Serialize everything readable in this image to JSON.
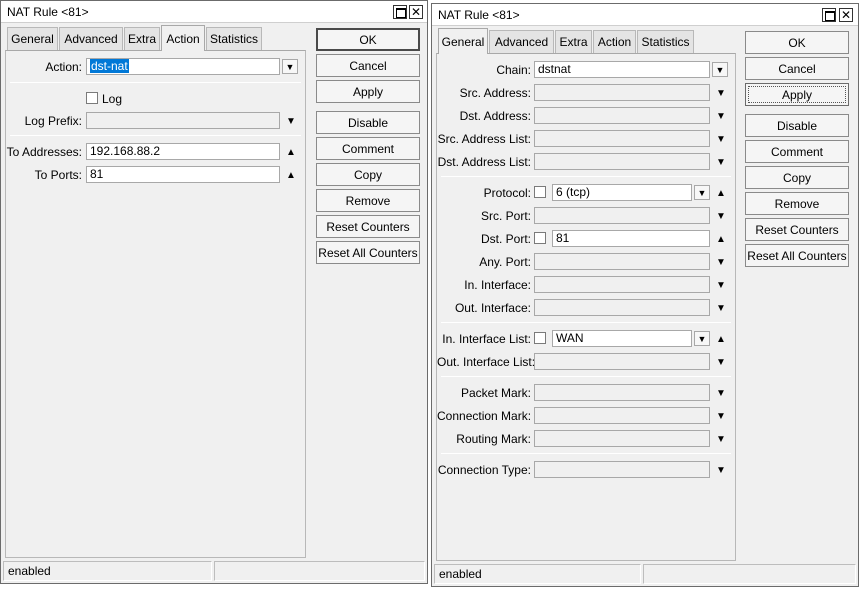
{
  "window1": {
    "title": "NAT Rule <81>",
    "tabs": [
      "General",
      "Advanced",
      "Extra",
      "Action",
      "Statistics"
    ],
    "active_tab": "Action",
    "fields": {
      "action_label": "Action:",
      "action_value": "dst-nat",
      "log_label": "Log",
      "log_prefix_label": "Log Prefix:",
      "log_prefix_value": "",
      "to_addresses_label": "To Addresses:",
      "to_addresses_value": "192.168.88.2",
      "to_ports_label": "To Ports:",
      "to_ports_value": "81"
    },
    "status": "enabled"
  },
  "window2": {
    "title": "NAT Rule <81>",
    "tabs": [
      "General",
      "Advanced",
      "Extra",
      "Action",
      "Statistics"
    ],
    "active_tab": "General",
    "fields": [
      {
        "label": "Chain:",
        "value": "dstnat"
      },
      {
        "label": "Src. Address:",
        "value": ""
      },
      {
        "label": "Dst. Address:",
        "value": ""
      },
      {
        "label": "Src. Address List:",
        "value": ""
      },
      {
        "label": "Dst. Address List:",
        "value": ""
      },
      {
        "label": "Protocol:",
        "value": "6 (tcp)"
      },
      {
        "label": "Src. Port:",
        "value": ""
      },
      {
        "label": "Dst. Port:",
        "value": "81"
      },
      {
        "label": "Any. Port:",
        "value": ""
      },
      {
        "label": "In. Interface:",
        "value": ""
      },
      {
        "label": "Out. Interface:",
        "value": ""
      },
      {
        "label": "In. Interface List:",
        "value": "WAN"
      },
      {
        "label": "Out. Interface List:",
        "value": ""
      },
      {
        "label": "Packet Mark:",
        "value": ""
      },
      {
        "label": "Connection Mark:",
        "value": ""
      },
      {
        "label": "Routing Mark:",
        "value": ""
      },
      {
        "label": "Connection Type:",
        "value": ""
      }
    ],
    "status": "enabled"
  },
  "buttons": [
    "OK",
    "Cancel",
    "Apply",
    "Disable",
    "Comment",
    "Copy",
    "Remove",
    "Reset Counters",
    "Reset All Counters"
  ]
}
